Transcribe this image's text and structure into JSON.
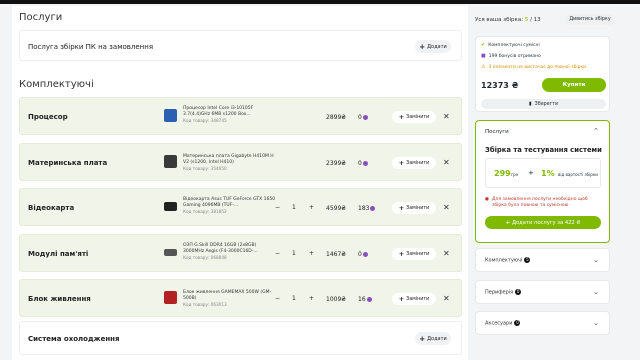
{
  "services_section": {
    "title": "Послуги",
    "row": {
      "name": "Послуга збірки ПК на замовлення",
      "add_label": "Додати"
    }
  },
  "components_section": {
    "title": "Комплектуючі",
    "rows": [
      {
        "name": "Процесор",
        "desc": "Процесор Intel Core i3-10105F 3.7(4.4)GHz 6MB s1200 Box...",
        "code": "Код товару: 348745",
        "qty": "",
        "price": "2899₴",
        "bonus": "0",
        "replace_label": "Замінити",
        "thumb_color": "#2b5fb3"
      },
      {
        "name": "Материнська плата",
        "desc": "Материнська плата Gigabyte H410M H V2 (s1200, Intel H410)",
        "code": "Код товару: 354650",
        "qty": "",
        "price": "2399₴",
        "bonus": "0",
        "replace_label": "Замінити",
        "thumb_color": "#3a3a3a"
      },
      {
        "name": "Відеокарта",
        "desc": "Відеокарта Asus TUF GeForce GTX 1650 Gaming 4096MB (TUF-...",
        "code": "Код товару: 381852",
        "qty": "1",
        "price": "4599₴",
        "bonus": "183",
        "replace_label": "Замінити",
        "thumb_color": "#222222"
      },
      {
        "name": "Модулі пам'яті",
        "desc": "ОЗП G.Skill DDR4 16GB (2x8GB) 3000MHz Aegis (F4-3000C16D-...",
        "code": "Код товару: 068848",
        "qty": "1",
        "price": "1467₴",
        "bonus": "0",
        "replace_label": "Замінити",
        "thumb_color": "#555555"
      },
      {
        "name": "Блок живлення",
        "desc": "Блок живлення GAMEMAX 500W (GM-500B)",
        "code": "Код товару: 063013",
        "qty": "1",
        "price": "1009₴",
        "bonus": "16",
        "replace_label": "Замінити",
        "thumb_color": "#b22222"
      }
    ],
    "cooling": {
      "name": "Система охолодження",
      "add_label": "Додати"
    }
  },
  "sidebar": {
    "build_label": "Уся ваша збірка:",
    "build_count": "5",
    "build_total": "13",
    "view_build_label": "Дивитись збірку",
    "summary": {
      "compat": "Комплектуючі сумісні",
      "bonus": "199 бонусів отримано",
      "missing": "3 елементи не вистачає до повної збірки",
      "total": "12373 ₴",
      "buy_label": "Купити",
      "save_label": "Зберегти"
    },
    "services_panel": {
      "header": "Послуги",
      "title": "Збірка та тестування системи",
      "price": "299",
      "currency": "грн",
      "plus": "+",
      "percent": "1%",
      "percent_note": "від вартості збірки",
      "warning": "Для замовлення послуги необхідно щоб збірка була повною та сумісною",
      "add_label": "Додати послугу за 422 ₴"
    },
    "collapsed": [
      {
        "label": "Комплектуючі",
        "badge": "5"
      },
      {
        "label": "Периферія",
        "badge": "0"
      },
      {
        "label": "Аксесуари",
        "badge": "0"
      }
    ]
  }
}
